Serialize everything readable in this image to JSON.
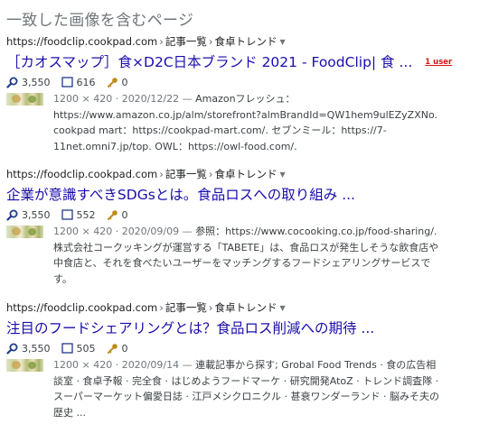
{
  "section_title": "一致した画像を含むページ",
  "results": [
    {
      "domain": "https://foodclip.cookpad.com",
      "crumb1": "記事一覧",
      "crumb2": "食卓トレンド",
      "title": "［カオスマップ］食×D2C日本ブランド 2021 - FoodClip| 食 ...",
      "badge": "1 user",
      "views": "3,550",
      "pages": "616",
      "keys": "0",
      "meta": "1200 × 420 · 2020/12/22 —",
      "snippet": "Amazonフレッシュ：https://www.amazon.co.jp/alm/storefront?almBrandId=QW1hem9ulEZyZXNo. cookpad mart：https://cookpad-mart.com/. セブンミール：https://7-11net.omni7.jp/top. OWL：https://owl-food.com/."
    },
    {
      "domain": "https://foodclip.cookpad.com",
      "crumb1": "記事一覧",
      "crumb2": "食卓トレンド",
      "title": "企業が意識すべきSDGsとは。食品ロスへの取り組み ...",
      "badge": "",
      "views": "3,550",
      "pages": "552",
      "keys": "0",
      "meta": "1200 × 420 · 2020/09/09 —",
      "snippet": "参照：https://www.cocooking.co.jp/food-sharing/. 株式会社コークッキングが運営する「TABETE」は、食品ロスが発生しそうな飲食店や中食店と、それを食べたいユーザーをマッチングするフードシェアリングサービスです。"
    },
    {
      "domain": "https://foodclip.cookpad.com",
      "crumb1": "記事一覧",
      "crumb2": "食卓トレンド",
      "title": "注目のフードシェアリングとは？食品ロス削減への期待 ...",
      "badge": "",
      "views": "3,550",
      "pages": "505",
      "keys": "0",
      "meta": "1200 × 420 · 2020/09/14 —",
      "snippet": "連載記事から探す; Grobal Food Trends · 食の広告相談室 · 食卓予報 · 完全食 · はじめようフードマーケ · 研究開発AtoZ · トレンド調査隊 · スーパーマーケット偏愛日誌 · 江戸メシクロニクル · 甚衰ワンダーランド · 脳みそ夫の歴史 ..."
    }
  ],
  "colors": {
    "link": "#1a0dab",
    "badge": "#d01716",
    "section_title": "#70757a",
    "icon_blue": "#1e3a8a",
    "icon_key": "#c08a1a"
  },
  "icons": {
    "views": "magnifier-icon",
    "pages": "page-icon",
    "keys": "key-icon",
    "menu": "caret-down-icon"
  }
}
